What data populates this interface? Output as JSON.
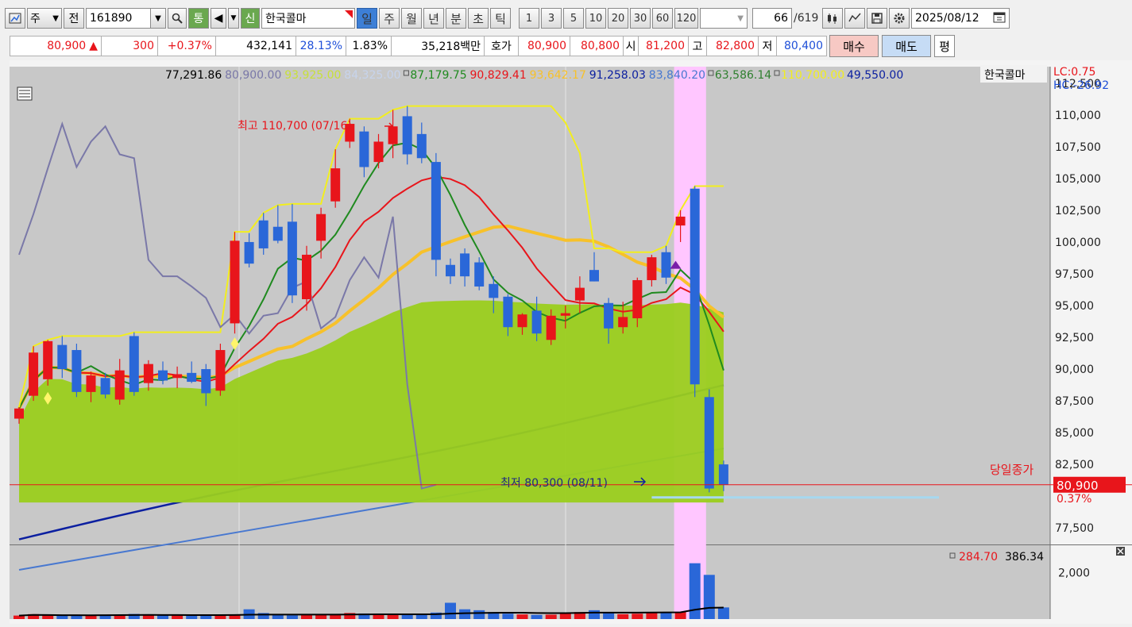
{
  "toolbar": {
    "type_label": "주",
    "prev_label": "전",
    "stock_code": "161890",
    "tong_label": "통",
    "sin_label": "신",
    "stock_name": "한국콜마",
    "periods": [
      "일",
      "주",
      "월",
      "년",
      "분",
      "초",
      "틱"
    ],
    "active_period": "일",
    "intervals": [
      "1",
      "3",
      "5",
      "10",
      "20",
      "30",
      "60",
      "120"
    ],
    "count": "66",
    "total": "/619",
    "date": "2025/08/12"
  },
  "quote": {
    "price": "80,900",
    "change": "300",
    "change_pct": "+0.37%",
    "volume": "432,141",
    "ratio": "28.13%",
    "turnover": "1.83%",
    "amount": "35,218백만",
    "hoga_label": "호가",
    "ask": "80,900",
    "bid": "80,800",
    "open_label": "시",
    "open": "81,200",
    "high_label": "고",
    "high": "82,800",
    "low_label": "저",
    "low": "80,400",
    "buy_label": "매수",
    "sell_label": "매도",
    "eval_label": "평"
  },
  "colors": {
    "up": "#e8151b",
    "down": "#2a67d8",
    "cloud": "#9bcf1e",
    "chart_bg": "#c8c8c8",
    "ma5": "#1f8a1f",
    "ma10": "#e8151b",
    "ma20": "#f7c12a",
    "ma60": "#0b1fa0",
    "ma120": "#4878d0",
    "envelope": "#f2ee1e",
    "lagging": "#7a78a8",
    "highlight": "#ffc6ff"
  },
  "chart_data": {
    "type": "candlestick",
    "ylim": [
      76200,
      113800
    ],
    "yticks": [
      "112,500",
      "110,000",
      "107,500",
      "105,000",
      "102,500",
      "100,000",
      "97,500",
      "95,000",
      "92,500",
      "90,000",
      "87,500",
      "85,000",
      "82,500",
      "80,000",
      "77,500"
    ],
    "legend_values": [
      {
        "text": "77,291.86",
        "color": "#000000"
      },
      {
        "text": "80,900.00",
        "color": "#7a78a8"
      },
      {
        "text": "93,925.00",
        "color": "#c8e03a"
      },
      {
        "text": "84,325.00",
        "color": "#c7d4ec"
      },
      {
        "text": "87,179.75",
        "color": "#1f8a1f",
        "box": true
      },
      {
        "text": "90,829.41",
        "color": "#e8151b"
      },
      {
        "text": "93,642.17",
        "color": "#f7c12a"
      },
      {
        "text": "91,258.03",
        "color": "#0b1fa0"
      },
      {
        "text": "83,840.20",
        "color": "#4878d0"
      },
      {
        "text": "63,586.14",
        "color": "#2f7f2f",
        "box": true
      },
      {
        "text": "110,700.00",
        "color": "#f2ee1e",
        "box": true
      },
      {
        "text": "49,550.00",
        "color": "#0b1fa0"
      }
    ],
    "legend_name": "한국콜마",
    "lc_label": "LC:0.75",
    "hc_label": "HC:-26.92",
    "high_annotation": "최고 110,700 (07/16)",
    "low_annotation": "최저 80,300 (08/11)",
    "close_label": "당일종가",
    "close_value": "80,900",
    "close_pct": "0.37%",
    "close_price": 80900,
    "candles": [
      {
        "o": 86100,
        "h": 87000,
        "l": 85700,
        "c": 86900
      },
      {
        "o": 87900,
        "h": 91800,
        "l": 87500,
        "c": 91300
      },
      {
        "o": 89200,
        "h": 92300,
        "l": 88700,
        "c": 92200
      },
      {
        "o": 91900,
        "h": 92600,
        "l": 89300,
        "c": 90000
      },
      {
        "o": 91500,
        "h": 92000,
        "l": 87800,
        "c": 88200
      },
      {
        "o": 88200,
        "h": 89800,
        "l": 87400,
        "c": 89500
      },
      {
        "o": 89300,
        "h": 89700,
        "l": 87700,
        "c": 88000
      },
      {
        "o": 87600,
        "h": 90800,
        "l": 87200,
        "c": 89900
      },
      {
        "o": 92600,
        "h": 92900,
        "l": 87900,
        "c": 88200
      },
      {
        "o": 88900,
        "h": 90700,
        "l": 88300,
        "c": 90400
      },
      {
        "o": 89900,
        "h": 90600,
        "l": 88800,
        "c": 89100
      },
      {
        "o": 89300,
        "h": 90200,
        "l": 88500,
        "c": 89600
      },
      {
        "o": 89700,
        "h": 90600,
        "l": 88900,
        "c": 89000
      },
      {
        "o": 90000,
        "h": 90400,
        "l": 87100,
        "c": 88100
      },
      {
        "o": 88300,
        "h": 92000,
        "l": 87900,
        "c": 91500
      },
      {
        "o": 93600,
        "h": 100800,
        "l": 92800,
        "c": 100100
      },
      {
        "o": 100000,
        "h": 100700,
        "l": 98000,
        "c": 98300
      },
      {
        "o": 101700,
        "h": 102300,
        "l": 99000,
        "c": 99500
      },
      {
        "o": 101200,
        "h": 102900,
        "l": 99900,
        "c": 100100
      },
      {
        "o": 101600,
        "h": 103000,
        "l": 95200,
        "c": 95800
      },
      {
        "o": 95500,
        "h": 99700,
        "l": 94600,
        "c": 99000
      },
      {
        "o": 100100,
        "h": 102700,
        "l": 98700,
        "c": 102200
      },
      {
        "o": 103200,
        "h": 107300,
        "l": 102700,
        "c": 105800
      },
      {
        "o": 107900,
        "h": 109700,
        "l": 107400,
        "c": 109300
      },
      {
        "o": 108700,
        "h": 109100,
        "l": 105100,
        "c": 105900
      },
      {
        "o": 106300,
        "h": 108500,
        "l": 105800,
        "c": 107900
      },
      {
        "o": 107700,
        "h": 110400,
        "l": 106600,
        "c": 109100
      },
      {
        "o": 109900,
        "h": 110700,
        "l": 106100,
        "c": 106900
      },
      {
        "o": 108500,
        "h": 109400,
        "l": 106200,
        "c": 106600
      },
      {
        "o": 106300,
        "h": 107000,
        "l": 97300,
        "c": 98600
      },
      {
        "o": 98200,
        "h": 98700,
        "l": 96700,
        "c": 97300
      },
      {
        "o": 99100,
        "h": 99500,
        "l": 96500,
        "c": 97300
      },
      {
        "o": 98400,
        "h": 98800,
        "l": 96200,
        "c": 96500
      },
      {
        "o": 96700,
        "h": 97300,
        "l": 94400,
        "c": 95600
      },
      {
        "o": 95700,
        "h": 95900,
        "l": 92600,
        "c": 93300
      },
      {
        "o": 93300,
        "h": 94400,
        "l": 92700,
        "c": 94300
      },
      {
        "o": 94600,
        "h": 95700,
        "l": 92200,
        "c": 92800
      },
      {
        "o": 92300,
        "h": 94700,
        "l": 91900,
        "c": 94200
      },
      {
        "o": 94200,
        "h": 95000,
        "l": 93200,
        "c": 94400
      },
      {
        "o": 95400,
        "h": 97300,
        "l": 94400,
        "c": 96400
      },
      {
        "o": 97800,
        "h": 99200,
        "l": 96900,
        "c": 96900
      },
      {
        "o": 95200,
        "h": 95600,
        "l": 92000,
        "c": 93200
      },
      {
        "o": 93300,
        "h": 95300,
        "l": 92800,
        "c": 94100
      },
      {
        "o": 94000,
        "h": 97200,
        "l": 93300,
        "c": 97000
      },
      {
        "o": 97000,
        "h": 99000,
        "l": 96500,
        "c": 98800
      },
      {
        "o": 99200,
        "h": 99700,
        "l": 96700,
        "c": 97200
      },
      {
        "o": 101300,
        "h": 102500,
        "l": 100000,
        "c": 102000
      },
      {
        "o": 104200,
        "h": 104400,
        "l": 87800,
        "c": 88800
      },
      {
        "o": 87800,
        "h": 88400,
        "l": 80300,
        "c": 80600
      },
      {
        "o": 82500,
        "h": 82800,
        "l": 80400,
        "c": 80900
      }
    ],
    "volume": {
      "ytick": "2,000",
      "legend_a": "284.70",
      "legend_b": "386.34",
      "values": [
        150,
        210,
        160,
        150,
        170,
        140,
        180,
        190,
        220,
        200,
        170,
        150,
        140,
        160,
        180,
        200,
        420,
        260,
        200,
        160,
        170,
        180,
        210,
        260,
        240,
        180,
        210,
        200,
        230,
        280,
        700,
        420,
        380,
        300,
        230,
        200,
        180,
        190,
        240,
        300,
        380,
        250,
        210,
        230,
        280,
        300,
        310,
        2400,
        1900,
        500
      ]
    }
  }
}
